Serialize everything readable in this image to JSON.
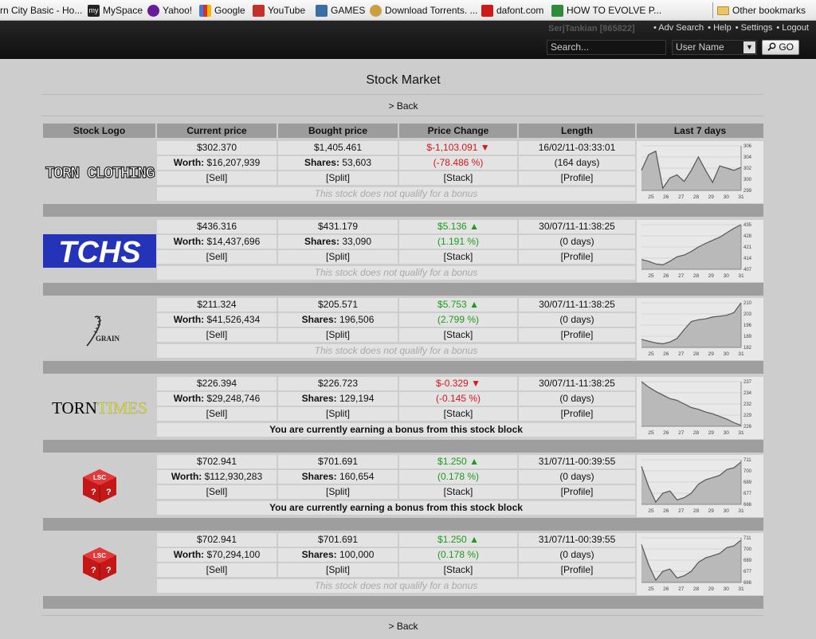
{
  "bookmarks": [
    {
      "label": "rn City Basic - Ho...",
      "icon": "torn-icon",
      "color": "#7a7a7a"
    },
    {
      "label": "MySpace",
      "icon": "myspace-icon",
      "color": "#222222"
    },
    {
      "label": "Yahoo!",
      "icon": "yahoo-icon",
      "color": "#6a1b9a"
    },
    {
      "label": "Google",
      "icon": "google-icon",
      "color": "#3b7be0"
    },
    {
      "label": "YouTube",
      "icon": "youtube-icon",
      "color": "#c4302b"
    },
    {
      "label": "GAMES",
      "icon": "games-icon",
      "color": "#3a6ea5"
    },
    {
      "label": "Download Torrents. ...",
      "icon": "torrent-icon",
      "color": "#c8a040"
    },
    {
      "label": "dafont.com",
      "icon": "dafont-icon",
      "color": "#cc1a1a"
    },
    {
      "label": "HOW TO EVOLVE P...",
      "icon": "evolve-icon",
      "color": "#2e8b3a"
    }
  ],
  "other_bookmarks": "Other bookmarks",
  "header": {
    "user": "SerjTankian [865822]",
    "links": [
      "• Adv Search",
      "• Help",
      "• Settings",
      "• Logout"
    ],
    "search_placeholder": "Search...",
    "user_select": "User Name",
    "go": "GO"
  },
  "page": {
    "title": "Stock Market",
    "back": "> Back"
  },
  "columns": [
    "Stock Logo",
    "Current price",
    "Bought price",
    "Price Change",
    "Length",
    "Last 7 days"
  ],
  "stocks": [
    {
      "logo": "TORN CLOTHING",
      "current": "$302.370",
      "worth_label": "Worth:",
      "worth": "$16,207,939",
      "bought": "$1,405.461",
      "shares_label": "Shares:",
      "shares": "53,603",
      "change": "$-1,103.091",
      "change_dir": "down",
      "change_pct": "(-78.486 %)",
      "date": "16/02/11-03:33:01",
      "days": "(164 days)",
      "sell": "[Sell]",
      "split": "[Split]",
      "stack": "[Stack]",
      "profile": "[Profile]",
      "bonus": "This stock does not qualify for a bonus",
      "bonus_type": "no",
      "spark": {
        "x": [
          "25",
          "26",
          "27",
          "28",
          "29",
          "30",
          "31"
        ],
        "y": [
          "306",
          "304",
          "302",
          "300",
          "299"
        ],
        "values": [
          0.55,
          0.2,
          0.12,
          0.95,
          0.72,
          0.65,
          0.8,
          0.55,
          0.25,
          0.55,
          0.82,
          0.45,
          0.5,
          0.55,
          0.48
        ]
      }
    },
    {
      "logo": "TCHS",
      "current": "$436.316",
      "worth_label": "Worth:",
      "worth": "$14,437,696",
      "bought": "$431.179",
      "shares_label": "Shares:",
      "shares": "33,090",
      "change": "$5.136",
      "change_dir": "up",
      "change_pct": "(1.191 %)",
      "date": "30/07/11-11:38:25",
      "days": "(0 days)",
      "sell": "[Sell]",
      "split": "[Split]",
      "stack": "[Stack]",
      "profile": "[Profile]",
      "bonus": "This stock does not qualify for a bonus",
      "bonus_type": "no",
      "spark": {
        "x": [
          "25",
          "26",
          "27",
          "28",
          "29",
          "30",
          "31"
        ],
        "y": [
          "435",
          "428",
          "421",
          "414",
          "407"
        ],
        "values": [
          0.78,
          0.82,
          0.88,
          0.9,
          0.82,
          0.72,
          0.68,
          0.6,
          0.5,
          0.42,
          0.35,
          0.28,
          0.18,
          0.08,
          0.0
        ]
      }
    },
    {
      "logo": "GRAIN",
      "current": "$211.324",
      "worth_label": "Worth:",
      "worth": "$41,526,434",
      "bought": "$205.571",
      "shares_label": "Shares:",
      "shares": "196,506",
      "change": "$5.753",
      "change_dir": "up",
      "change_pct": "(2.799 %)",
      "date": "30/07/11-11:38:25",
      "days": "(0 days)",
      "sell": "[Sell]",
      "split": "[Split]",
      "stack": "[Stack]",
      "profile": "[Profile]",
      "bonus": "This stock does not qualify for a bonus",
      "bonus_type": "no",
      "spark": {
        "x": [
          "25",
          "26",
          "27",
          "28",
          "29",
          "30",
          "31"
        ],
        "y": [
          "210",
          "203",
          "196",
          "189",
          "182"
        ],
        "values": [
          0.82,
          0.86,
          0.9,
          0.92,
          0.88,
          0.8,
          0.6,
          0.42,
          0.38,
          0.36,
          0.32,
          0.3,
          0.28,
          0.22,
          0.0
        ]
      }
    },
    {
      "logo": "TORN TIMES",
      "current": "$226.394",
      "worth_label": "Worth:",
      "worth": "$29,248,746",
      "bought": "$226.723",
      "shares_label": "Shares:",
      "shares": "129,194",
      "change": "$-0.329",
      "change_dir": "down",
      "change_pct": "(-0.145 %)",
      "date": "30/07/11-11:38:25",
      "days": "(0 days)",
      "sell": "[Sell]",
      "split": "[Split]",
      "stack": "[Stack]",
      "profile": "[Profile]",
      "bonus": "You are currently earning a bonus from this stock block",
      "bonus_type": "yes",
      "spark": {
        "x": [
          "25",
          "26",
          "27",
          "28",
          "29",
          "30",
          "31"
        ],
        "y": [
          "237",
          "234",
          "232",
          "229",
          "226"
        ],
        "values": [
          0.0,
          0.12,
          0.22,
          0.3,
          0.38,
          0.42,
          0.5,
          0.58,
          0.62,
          0.68,
          0.72,
          0.78,
          0.84,
          0.92,
          0.98
        ]
      }
    },
    {
      "logo": "LSC",
      "current": "$702.941",
      "worth_label": "Worth:",
      "worth": "$112,930,283",
      "bought": "$701.691",
      "shares_label": "Shares:",
      "shares": "160,654",
      "change": "$1.250",
      "change_dir": "up",
      "change_pct": "(0.178 %)",
      "date": "31/07/11-00:39:55",
      "days": "(0 days)",
      "sell": "[Sell]",
      "split": "[Split]",
      "stack": "[Stack]",
      "profile": "[Profile]",
      "bonus": "You are currently earning a bonus from this stock block",
      "bonus_type": "yes",
      "spark": {
        "x": [
          "25",
          "26",
          "27",
          "28",
          "29",
          "30",
          "31"
        ],
        "y": [
          "711",
          "700",
          "689",
          "677",
          "666"
        ],
        "values": [
          0.15,
          0.6,
          0.95,
          0.75,
          0.7,
          0.9,
          0.85,
          0.75,
          0.55,
          0.45,
          0.4,
          0.35,
          0.22,
          0.18,
          0.05
        ]
      }
    },
    {
      "logo": "LSC",
      "current": "$702.941",
      "worth_label": "Worth:",
      "worth": "$70,294,100",
      "bought": "$701.691",
      "shares_label": "Shares:",
      "shares": "100,000",
      "change": "$1.250",
      "change_dir": "up",
      "change_pct": "(0.178 %)",
      "date": "31/07/11-00:39:55",
      "days": "(0 days)",
      "sell": "[Sell]",
      "split": "[Split]",
      "stack": "[Stack]",
      "profile": "[Profile]",
      "bonus": "This stock does not qualify for a bonus",
      "bonus_type": "no",
      "spark": {
        "x": [
          "25",
          "26",
          "27",
          "28",
          "29",
          "30",
          "31"
        ],
        "y": [
          "711",
          "700",
          "689",
          "677",
          "666"
        ],
        "values": [
          0.15,
          0.6,
          0.95,
          0.75,
          0.7,
          0.9,
          0.85,
          0.75,
          0.55,
          0.45,
          0.4,
          0.35,
          0.22,
          0.18,
          0.05
        ]
      }
    }
  ]
}
